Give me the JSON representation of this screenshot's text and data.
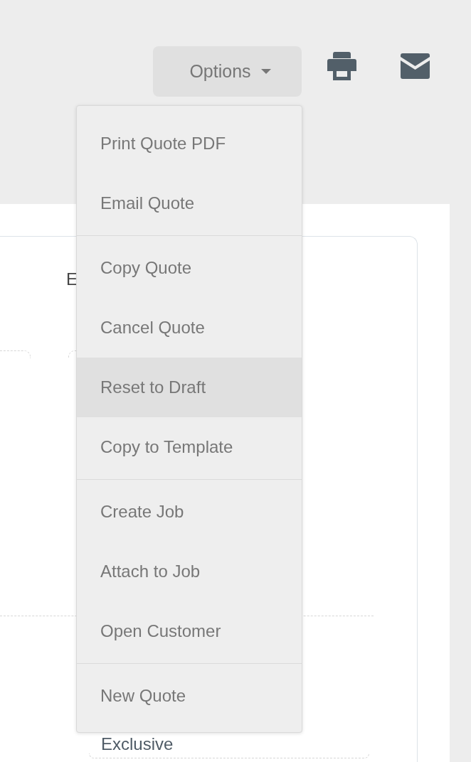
{
  "toolbar": {
    "options_button": {
      "label": "Options"
    }
  },
  "menu": {
    "groups": [
      {
        "items": [
          {
            "label": "Print Quote PDF",
            "selected": false
          },
          {
            "label": "Email Quote",
            "selected": false
          }
        ]
      },
      {
        "items": [
          {
            "label": "Copy Quote",
            "selected": false
          },
          {
            "label": "Cancel Quote",
            "selected": false
          },
          {
            "label": "Reset to Draft",
            "selected": true
          },
          {
            "label": "Copy to Template",
            "selected": false
          }
        ]
      },
      {
        "items": [
          {
            "label": "Create Job",
            "selected": false
          },
          {
            "label": "Attach to Job",
            "selected": false
          },
          {
            "label": "Open Customer",
            "selected": false
          }
        ]
      },
      {
        "items": [
          {
            "label": "New Quote",
            "selected": false
          }
        ]
      }
    ]
  },
  "card": {
    "heading": "E",
    "value": "Exclusive"
  }
}
